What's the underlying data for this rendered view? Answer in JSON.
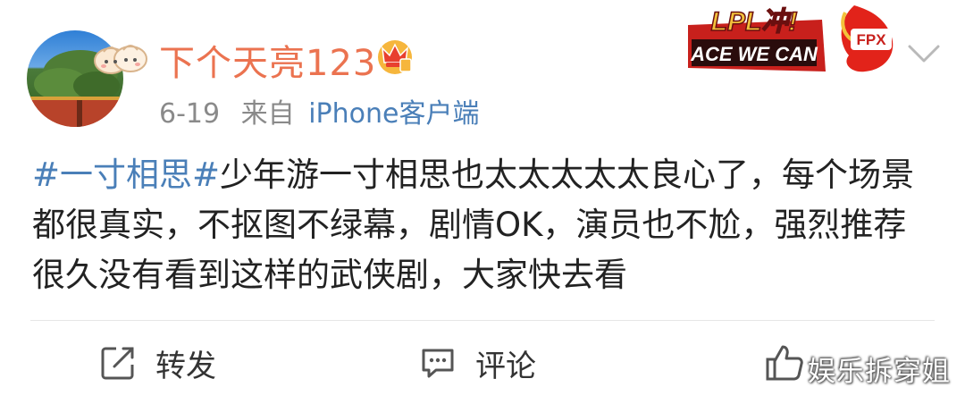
{
  "user": {
    "name": "下个天亮123",
    "vip_icon": "crown-icon"
  },
  "meta": {
    "date": "6-19",
    "source_prefix": "来自",
    "source": "iPhone客户端"
  },
  "badge": {
    "top_text": "LPL冲!",
    "bottom_text": "ACE WE CAN",
    "team": "FPX",
    "colors": {
      "red": "#d7261e",
      "gold": "#f3c23b"
    }
  },
  "post": {
    "topic": "#一寸相思#",
    "text": "少年游一寸相思也太太太太太良心了，每个场景都很真实，不抠图不绿幕，剧情OK，演员也不尬，强烈推荐很久没有看到这样的武侠剧，大家快去看"
  },
  "actions": {
    "repost": "转发",
    "comment": "评论",
    "like": ""
  },
  "watermark": "娱乐拆穿姐",
  "colors": {
    "username": "#eb7350",
    "topic": "#4a7fb8",
    "meta": "#8a8a8a"
  }
}
